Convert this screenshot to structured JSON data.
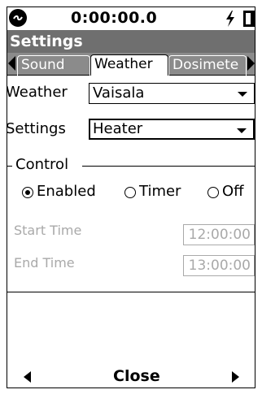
{
  "status": {
    "timer": "0:00:00.0",
    "icons": [
      "status-circle-icon",
      "power-icon",
      "battery-icon"
    ]
  },
  "header": {
    "title": "Settings"
  },
  "tabs": [
    {
      "label": "Sound",
      "active": false
    },
    {
      "label": "Weather",
      "active": true
    },
    {
      "label": "Dosimete",
      "active": false
    }
  ],
  "form": {
    "weather": {
      "label": "Weather",
      "value": "Vaisala"
    },
    "settings": {
      "label": "Settings",
      "value": "Heater"
    },
    "control": {
      "title": "Control",
      "options": [
        {
          "label": "Enabled",
          "selected": true
        },
        {
          "label": "Timer",
          "selected": false
        },
        {
          "label": "Off",
          "selected": false
        }
      ]
    },
    "start_time": {
      "label": "Start Time",
      "value": "12:00:00"
    },
    "end_time": {
      "label": "End Time",
      "value": "13:00:00"
    }
  },
  "bottom": {
    "close_label": "Close"
  },
  "colors": {
    "header_bg": "#6f6f6f",
    "tab_strip_bg": "#8b8b8b",
    "disabled": "#a9a9a9"
  }
}
